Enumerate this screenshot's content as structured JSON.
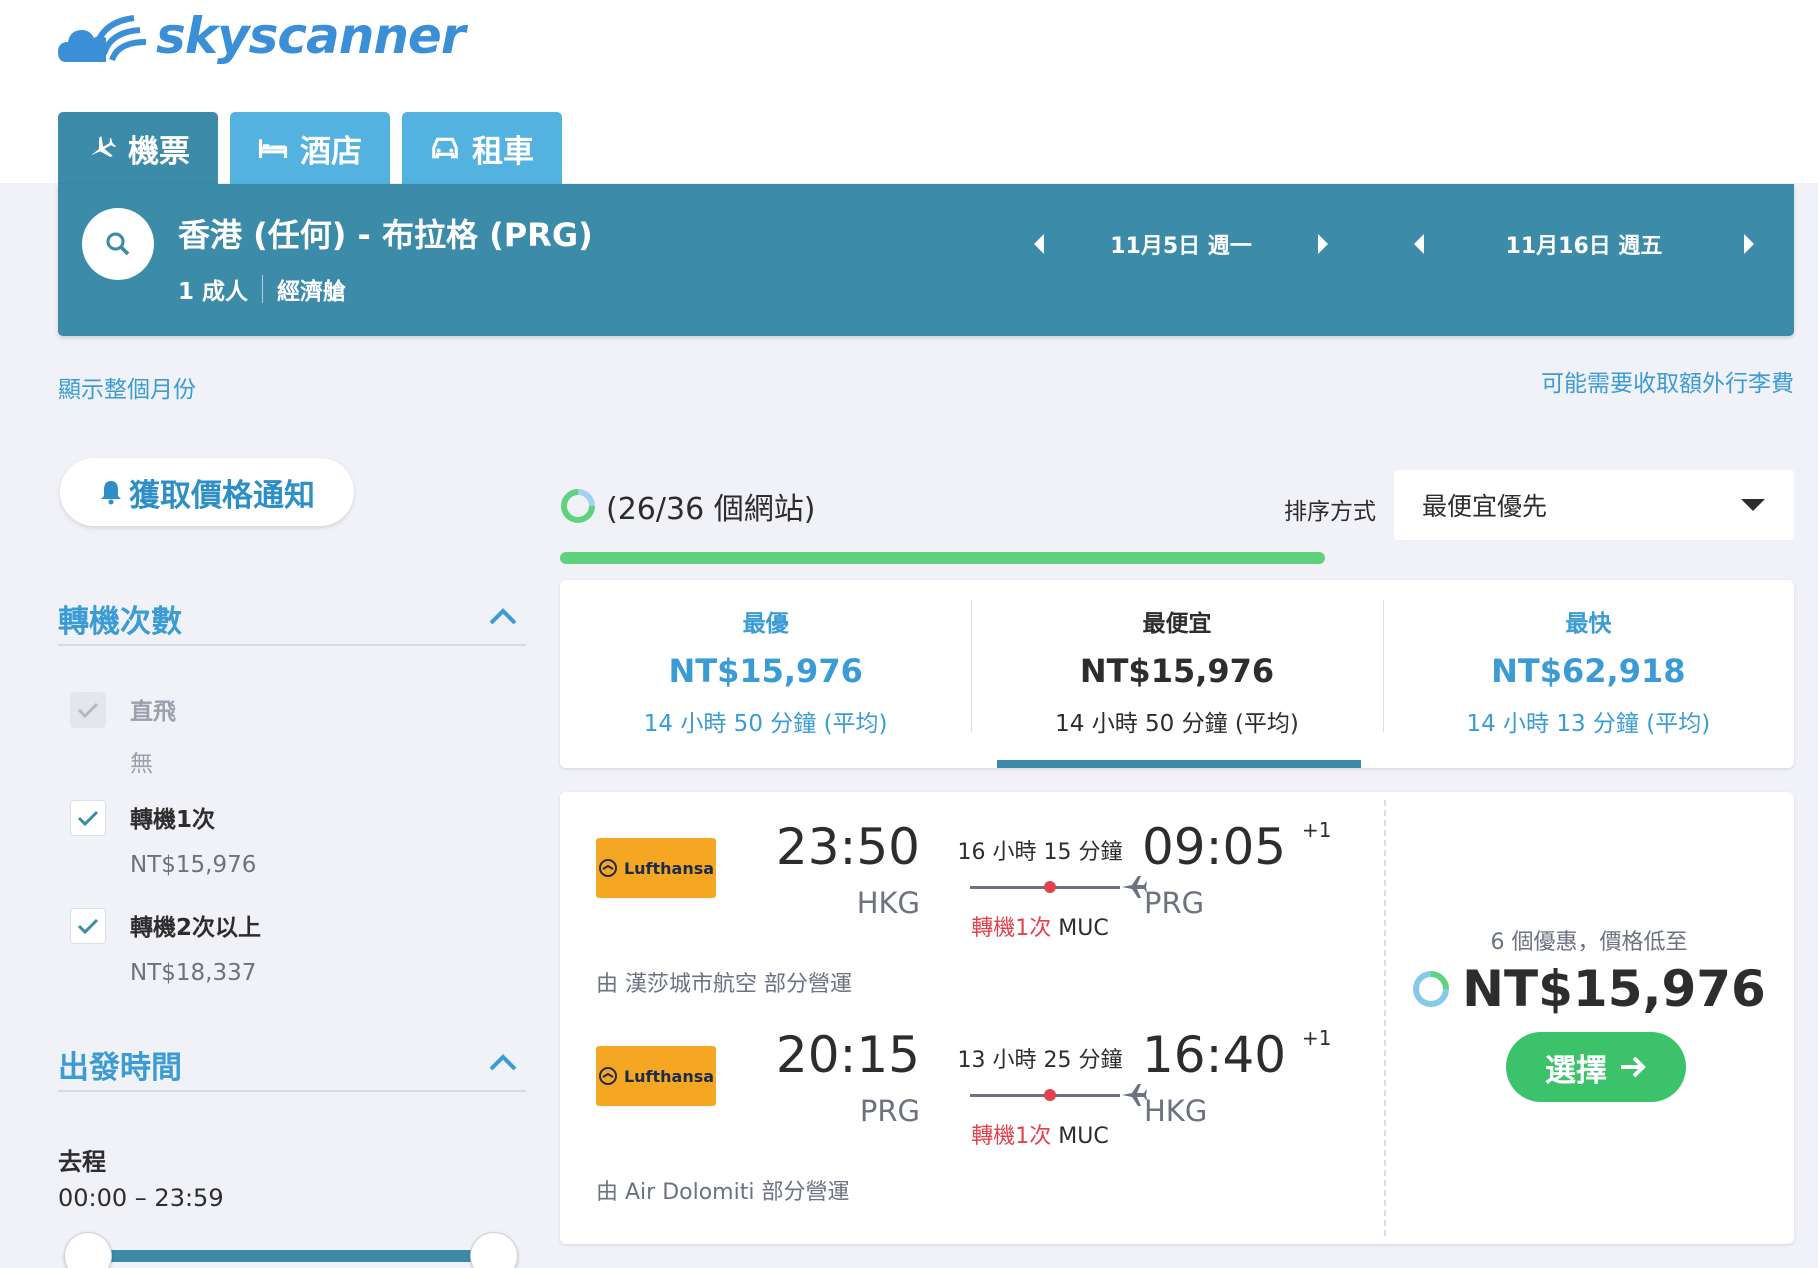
{
  "brand": {
    "name": "skyscanner"
  },
  "tabs": [
    {
      "label": "機票",
      "icon": "plane-icon",
      "active": true
    },
    {
      "label": "酒店",
      "icon": "bed-icon",
      "active": false
    },
    {
      "label": "租車",
      "icon": "car-icon",
      "active": false
    }
  ],
  "search": {
    "route": "香港 (任何) - 布拉格 (PRG)",
    "passengers": "1 成人",
    "cabin": "經濟艙",
    "depart_date": "11月5日 週一",
    "return_date": "11月16日 週五"
  },
  "links": {
    "show_month": "顯示整個月份",
    "bag_fees": "可能需要收取額外行李費"
  },
  "price_alert": "獲取價格通知",
  "filters": {
    "stops": {
      "title": "轉機次數",
      "options": [
        {
          "label": "直飛",
          "sub": "無",
          "checked": true,
          "disabled": true
        },
        {
          "label": "轉機1次",
          "sub": "NT$15,976",
          "checked": true,
          "disabled": false
        },
        {
          "label": "轉機2次以上",
          "sub": "NT$18,337",
          "checked": true,
          "disabled": false
        }
      ]
    },
    "departure_time": {
      "title": "出發時間",
      "outbound_label": "去程",
      "outbound_range": "00:00 – 23:59"
    }
  },
  "progress": {
    "label": "(26/36 個網站)",
    "fraction": 0.62
  },
  "sort": {
    "label": "排序方式",
    "selected": "最便宜優先"
  },
  "summary": [
    {
      "heading": "最優",
      "price": "NT$15,976",
      "duration": "14 小時 50 分鐘 (平均)",
      "active": false
    },
    {
      "heading": "最便宜",
      "price": "NT$15,976",
      "duration": "14 小時 50 分鐘 (平均)",
      "active": true
    },
    {
      "heading": "最快",
      "price": "NT$62,918",
      "duration": "14 小時 13 分鐘 (平均)",
      "active": false
    }
  ],
  "result": {
    "legs": [
      {
        "airline": "Lufthansa",
        "depart_time": "23:50",
        "depart_airport": "HKG",
        "duration": "16 小時 15 分鐘",
        "stops": "轉機1次",
        "via": "MUC",
        "arrive_time": "09:05",
        "arrive_day": "+1",
        "arrive_airport": "PRG",
        "operated": "由 漢莎城市航空 部分營運"
      },
      {
        "airline": "Lufthansa",
        "depart_time": "20:15",
        "depart_airport": "PRG",
        "duration": "13 小時 25 分鐘",
        "stops": "轉機1次",
        "via": "MUC",
        "arrive_time": "16:40",
        "arrive_day": "+1",
        "arrive_airport": "HKG",
        "operated": "由 Air Dolomiti 部分營運"
      }
    ],
    "deals": "6 個優惠，價格低至",
    "price": "NT$15,976",
    "select_label": "選擇"
  },
  "colors": {
    "brand_blue": "#3c8ba8",
    "tab_blue": "#53b2df",
    "link_blue": "#3a9bd5",
    "progress_green": "#60d27e",
    "select_green": "#3bc26b",
    "stop_red": "#e3414c",
    "airline_yellow": "#f5a623"
  }
}
